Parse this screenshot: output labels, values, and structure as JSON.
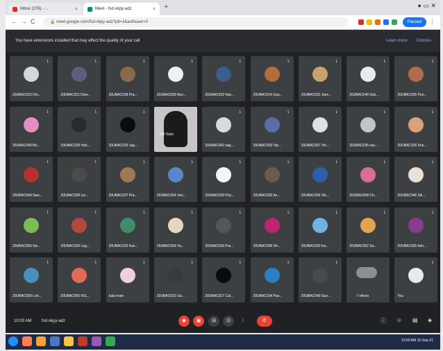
{
  "browser": {
    "tabs": [
      {
        "title": "Inbox (276) - ...",
        "active": false,
        "favicon_color": "#d93025"
      },
      {
        "title": "Meet - fsd-xkpy-adz",
        "active": true,
        "favicon_color": "#00897b"
      }
    ],
    "new_tab": "+",
    "url": "meet.google.com/fsd-xkpy-adz?pli=1&authuser=0",
    "back": "←",
    "forward": "→",
    "reload": "C",
    "profile_label": "Paused",
    "extension_colors": [
      "#d93025",
      "#fbbc04",
      "#e8710a",
      "#1a73e8",
      "#34a853"
    ]
  },
  "meet": {
    "banner_text": "You have extensions installed that may affect the quality of your call",
    "learn_more": "Learn more",
    "dismiss": "Dismiss",
    "meeting_time": "10:03 AM",
    "meeting_code": "fsd-xkpy-adz",
    "end_call_label": "✆",
    "control_icons": [
      "mic-off",
      "camera-off",
      "captions",
      "present",
      "more"
    ],
    "right_icons": [
      "info",
      "people",
      "chat",
      "activities"
    ],
    "participants": [
      {
        "name": "20UBAC010 Dhi...",
        "color": "#d4d8dc"
      },
      {
        "name": "20UBAC011 Dine...",
        "color": "#5a5f7a"
      },
      {
        "name": "20UBAC038 Pra...",
        "color": "#8a6a4b"
      },
      {
        "name": "20UBAC006 Bav...",
        "color": "#f0f0f0"
      },
      {
        "name": "20UBAC032 Nav...",
        "color": "#3b5e8a"
      },
      {
        "name": "20UBAC014 Gay...",
        "color": "#b56c3a"
      },
      {
        "name": "20UBAC031 Sam...",
        "color": "#c9a36b"
      },
      {
        "name": "20UBAC040 Sub...",
        "color": "#eaeaea"
      },
      {
        "name": "20UBAC035 Pun...",
        "color": "#b26b4c"
      },
      {
        "name": "20UBAC040 Bri...",
        "color": "#e48fc0"
      },
      {
        "name": "20UBAC018 Hari...",
        "color": "#2b2b2b"
      },
      {
        "name": "20UBAC019 Jag...",
        "color": "#111111",
        "dark": true
      },
      {
        "name": "RIZ Ram",
        "video": true
      },
      {
        "name": "20UBAC042 sag...",
        "color": "#dadada"
      },
      {
        "name": "20UBAC053 Var...",
        "color": "#5b6fa6"
      },
      {
        "name": "20UBAC057 Vin...",
        "color": "#e0e0e0"
      },
      {
        "name": "20UBAC035 sss...",
        "color": "#c1c4c8"
      },
      {
        "name": "20UBAC026 Kris...",
        "color": "#d9a07a"
      },
      {
        "name": "20UBAC044 Swe...",
        "color": "#b5322f"
      },
      {
        "name": "20UBAC028 Lin...",
        "color": "#4e4a46"
      },
      {
        "name": "20UBAC037 Pra...",
        "color": "#9d7a52"
      },
      {
        "name": "20UBAC054 Ven...",
        "color": "#5a86c9"
      },
      {
        "name": "20UBAC039 Priy...",
        "color": "#f5f5f5"
      },
      {
        "name": "20UBAC003 Av...",
        "color": "#6d5a48"
      },
      {
        "name": "20UBAC056 Vik...",
        "color": "#2f5fa8"
      },
      {
        "name": "20UBAC008 Ch...",
        "color": "#d86f8e"
      },
      {
        "name": "20UBAC046 SA...",
        "color": "#e9e2da"
      },
      {
        "name": "20UBAC050 Sw...",
        "color": "#7bbd55"
      },
      {
        "name": "20UBAC029 Log...",
        "color": "#b1493f"
      },
      {
        "name": "20UBAC023 Kav...",
        "color": "#3f8b6a"
      },
      {
        "name": "20UBAC059 Ya...",
        "color": "#e6d8c0"
      },
      {
        "name": "20UBAC036 Pra...",
        "color": "#555555"
      },
      {
        "name": "20UBAC009 Dh...",
        "color": "#c02470"
      },
      {
        "name": "20UBAC020 Ka...",
        "color": "#6fb3e3"
      },
      {
        "name": "20UBAC052 Sa...",
        "color": "#e2a24f"
      },
      {
        "name": "20UBAC025 Ash...",
        "color": "#8a3c8e"
      },
      {
        "name": "20UBAC030 Loh...",
        "color": "#4a8fbf"
      },
      {
        "name": "20UBAC055 KIS...",
        "color": "#e26b55"
      },
      {
        "name": "kala mani",
        "color": "#f0d0d8"
      },
      {
        "name": "20UBAC015 Go...",
        "color": "#3a3a3a"
      },
      {
        "name": "20UBAC017 Cal...",
        "color": "#0d0d0d",
        "dark": true
      },
      {
        "name": "20UBAC034 Pav...",
        "color": "#2e7fc1"
      },
      {
        "name": "20UBAC049 Sun...",
        "color": "#4a4a4a"
      },
      {
        "name": "7 others",
        "color": "#8a8f96",
        "others": true
      },
      {
        "name": "You",
        "color": "#e8e8f0"
      }
    ]
  },
  "taskbar": {
    "icon_colors": [
      "#1e90ff",
      "#ff7f50",
      "#f4a234",
      "#4a78c5",
      "#f5c542",
      "#c0392b",
      "#9b59b6",
      "#34a853"
    ],
    "time": "10:03 AM",
    "date": "15-Sep-21"
  }
}
